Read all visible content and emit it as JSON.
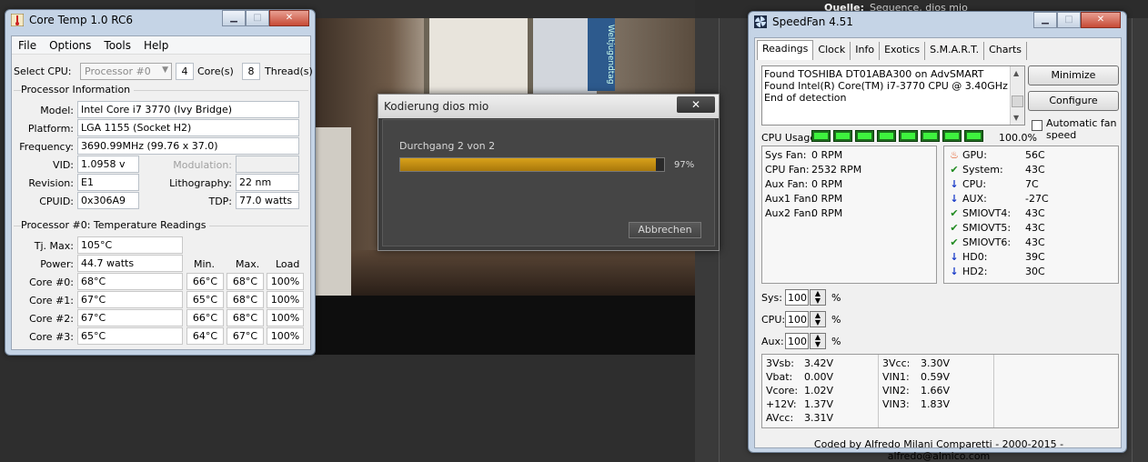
{
  "background": {
    "header_label": "Quelle:",
    "header_value": "Sequence, dios mio",
    "video_banner": "Weltjugendtag"
  },
  "coretemp": {
    "title": "Core Temp 1.0 RC6",
    "menu": [
      "File",
      "Options",
      "Tools",
      "Help"
    ],
    "select_cpu_label": "Select CPU:",
    "select_cpu_value": "Processor #0",
    "cores_count": "4",
    "cores_label": "Core(s)",
    "threads_count": "8",
    "threads_label": "Thread(s)",
    "processor_info_title": "Processor Information",
    "model_label": "Model:",
    "model_value": "Intel Core i7 3770 (Ivy Bridge)",
    "platform_label": "Platform:",
    "platform_value": "LGA 1155 (Socket H2)",
    "frequency_label": "Frequency:",
    "frequency_value": "3690.99MHz (99.76 x 37.0)",
    "vid_label": "VID:",
    "vid_value": "1.0958 v",
    "modulation_label": "Modulation:",
    "modulation_value": "",
    "revision_label": "Revision:",
    "revision_value": "E1",
    "lithography_label": "Lithography:",
    "lithography_value": "22 nm",
    "cpuid_label": "CPUID:",
    "cpuid_value": "0x306A9",
    "tdp_label": "TDP:",
    "tdp_value": "77.0 watts",
    "temp_title": "Processor #0: Temperature Readings",
    "tjmax_label": "Tj. Max:",
    "tjmax_value": "105°C",
    "power_label": "Power:",
    "power_value": "44.7 watts",
    "col_min": "Min.",
    "col_max": "Max.",
    "col_load": "Load",
    "cores": [
      {
        "label": "Core #0:",
        "temp": "68°C",
        "min": "66°C",
        "max": "68°C",
        "load": "100%"
      },
      {
        "label": "Core #1:",
        "temp": "67°C",
        "min": "65°C",
        "max": "68°C",
        "load": "100%"
      },
      {
        "label": "Core #2:",
        "temp": "67°C",
        "min": "66°C",
        "max": "68°C",
        "load": "100%"
      },
      {
        "label": "Core #3:",
        "temp": "65°C",
        "min": "64°C",
        "max": "67°C",
        "load": "100%"
      }
    ]
  },
  "encoding": {
    "title": "Kodierung dios mio",
    "close_glyph": "✕",
    "pass_text": "Durchgang 2 von 2",
    "progress": 97,
    "progress_text": "97%",
    "cancel_label": "Abbrechen"
  },
  "speedfan": {
    "title": "SpeedFan 4.51",
    "tabs": [
      "Readings",
      "Clock",
      "Info",
      "Exotics",
      "S.M.A.R.T.",
      "Charts"
    ],
    "log": [
      "Found TOSHIBA DT01ABA300 on AdvSMART",
      "Found Intel(R) Core(TM) i7-3770 CPU @ 3.40GHz",
      "End of detection"
    ],
    "minimize_label": "Minimize",
    "configure_label": "Configure",
    "auto_fan_label": "Automatic fan speed",
    "cpu_usage_label": "CPU Usage",
    "cpu_usage_value": "100.0%",
    "fans": [
      {
        "name": "Sys Fan:",
        "value": "0 RPM"
      },
      {
        "name": "CPU Fan:",
        "value": "2532 RPM"
      },
      {
        "name": "Aux Fan:",
        "value": "0 RPM"
      },
      {
        "name": "Aux1 Fan:",
        "value": "0 RPM"
      },
      {
        "name": "Aux2 Fan:",
        "value": "0 RPM"
      }
    ],
    "temps": [
      {
        "icon": "flame-icon",
        "name": "GPU:",
        "value": "56C"
      },
      {
        "icon": "check-icon",
        "name": "System:",
        "value": "43C"
      },
      {
        "icon": "arrow-down-icon",
        "name": "CPU:",
        "value": "7C"
      },
      {
        "icon": "arrow-down-icon",
        "name": "AUX:",
        "value": "-27C"
      },
      {
        "icon": "check-icon",
        "name": "SMIOVT4:",
        "value": "43C"
      },
      {
        "icon": "check-icon",
        "name": "SMIOVT5:",
        "value": "43C"
      },
      {
        "icon": "check-icon",
        "name": "SMIOVT6:",
        "value": "43C"
      },
      {
        "icon": "arrow-down-icon",
        "name": "HD0:",
        "value": "39C"
      },
      {
        "icon": "arrow-down-icon",
        "name": "HD2:",
        "value": "30C"
      }
    ],
    "speeds": [
      {
        "name": "Sys:",
        "value": "100",
        "unit": "%"
      },
      {
        "name": "CPU:",
        "value": "100",
        "unit": "%"
      },
      {
        "name": "Aux:",
        "value": "100",
        "unit": "%"
      }
    ],
    "voltages_left": [
      {
        "name": "3Vsb:",
        "value": "3.42V"
      },
      {
        "name": "Vbat:",
        "value": "0.00V"
      },
      {
        "name": "Vcore:",
        "value": "1.02V"
      },
      {
        "name": "+12V:",
        "value": "1.37V"
      },
      {
        "name": "AVcc:",
        "value": "3.31V"
      }
    ],
    "voltages_right": [
      {
        "name": "3Vcc:",
        "value": "3.30V"
      },
      {
        "name": "VIN1:",
        "value": "0.59V"
      },
      {
        "name": "VIN2:",
        "value": "1.66V"
      },
      {
        "name": "VIN3:",
        "value": "1.83V"
      }
    ],
    "footer": "Coded by Alfredo Milani Comparetti - 2000-2015 - alfredo@almico.com",
    "colors": {
      "ok": "#1e8a1e",
      "low": "#1a3cc8",
      "hot": "#e04a10",
      "bar": "#3ef23e"
    }
  }
}
